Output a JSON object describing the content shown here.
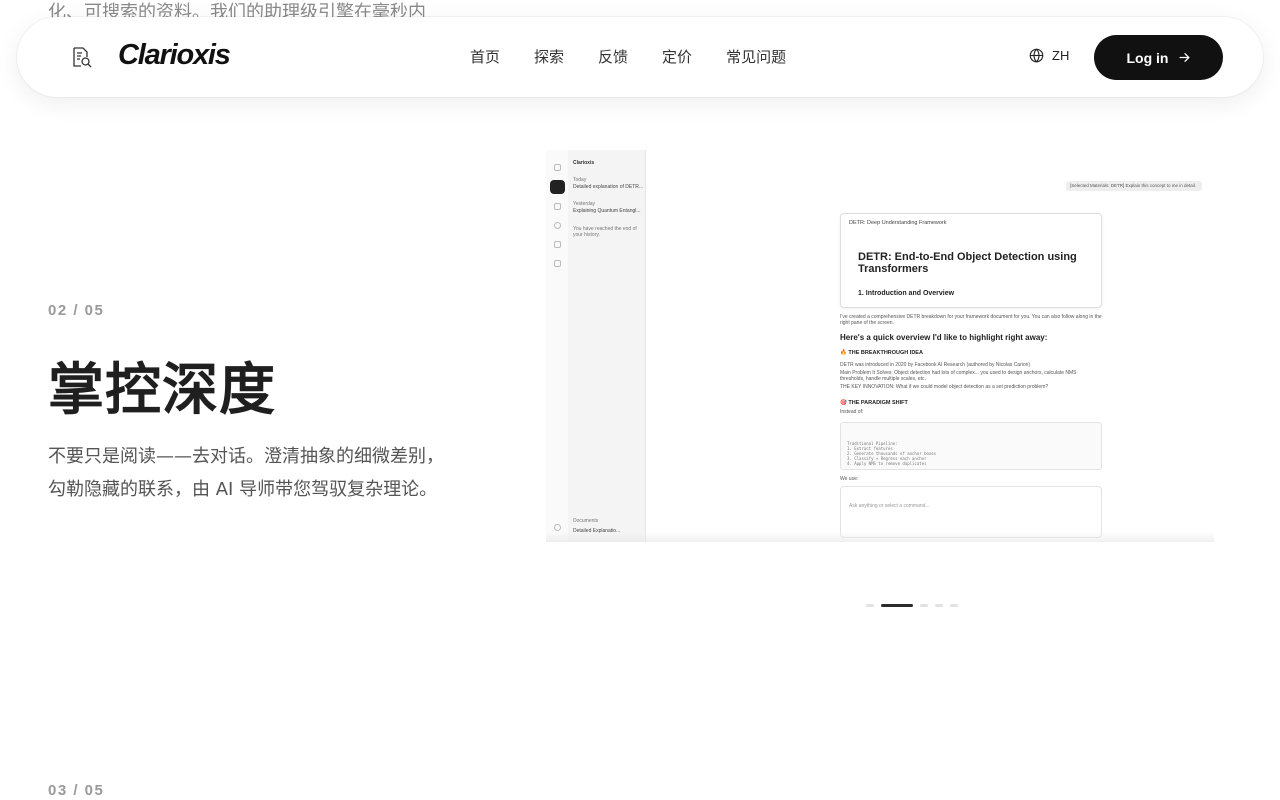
{
  "top_fragment": "化、可搜索的资料。我们的助理级引擎在毫秒内",
  "nav": {
    "logo_icon": "document-search-icon",
    "brand": "Clarioxis",
    "links": [
      "首页",
      "探索",
      "反馈",
      "定价",
      "常见问题"
    ],
    "language_icon": "globe-icon",
    "language": "ZH",
    "login_label": "Log in",
    "login_icon": "arrow-right-icon"
  },
  "feature": {
    "counter": "02 / 05",
    "title": "掌控深度",
    "description": "不要只是阅读——去对话。澄清抽象的细微差别，勾勒隐藏的联系，由 AI 导师带您驾驭复杂理论。"
  },
  "preview": {
    "sidebar_app": "Clarioxis",
    "sidebar_today": "Today",
    "sidebar_item_1": "Detailed explanation of DETR...",
    "sidebar_yesterday": "Yesterday",
    "sidebar_item_2": "Explaining Quantum Entangl...",
    "sidebar_end": "You have reached the end of your history.",
    "sidebar_documents": "Documents",
    "sidebar_doc_item": "Detailed Explanatio...",
    "chip": "[Selected Materials: DETR]  Explain this concept to me in detail.",
    "doc_card_head": "DETR: Deep Understanding Framework",
    "doc_title": "DETR: End-to-End Object Detection using Transformers",
    "doc_section": "1. Introduction and Overview",
    "intro_para": "I've created a comprehensive DETR breakdown for your framework document for you. You can also follow along in the right pane of the screen.",
    "overview_heading": "Here's a quick overview I'd like to highlight right away:",
    "breakthrough": "🔥 THE BREAKTHROUGH IDEA",
    "bullets": [
      "DETR was introduced in 2020 by Facebook AI Research (authored by Nicolas Carion)",
      "Main Problem It Solves: Object detection had lots of complex... you used to design anchors, calculate NMS thresholds, handle multiple scales, etc.",
      "THE KEY INNOVATION: What if we could model object detection as a set prediction problem?"
    ],
    "paradigm": "🎯 THE PARADIGM SHIFT",
    "instead": "Instead of:",
    "code_lines": [
      "Traditional Pipeline:",
      "1. Extract features",
      "2. Generate thousands of anchor boxes",
      "3. Classify + Regress each anchor",
      "4. Apply NMS to remove duplicates"
    ],
    "we_use": "We use:",
    "input_placeholder": "Ask anything or select a command..."
  },
  "carousel": {
    "count": 5,
    "active_index": 1
  },
  "next_counter": "03 / 05"
}
